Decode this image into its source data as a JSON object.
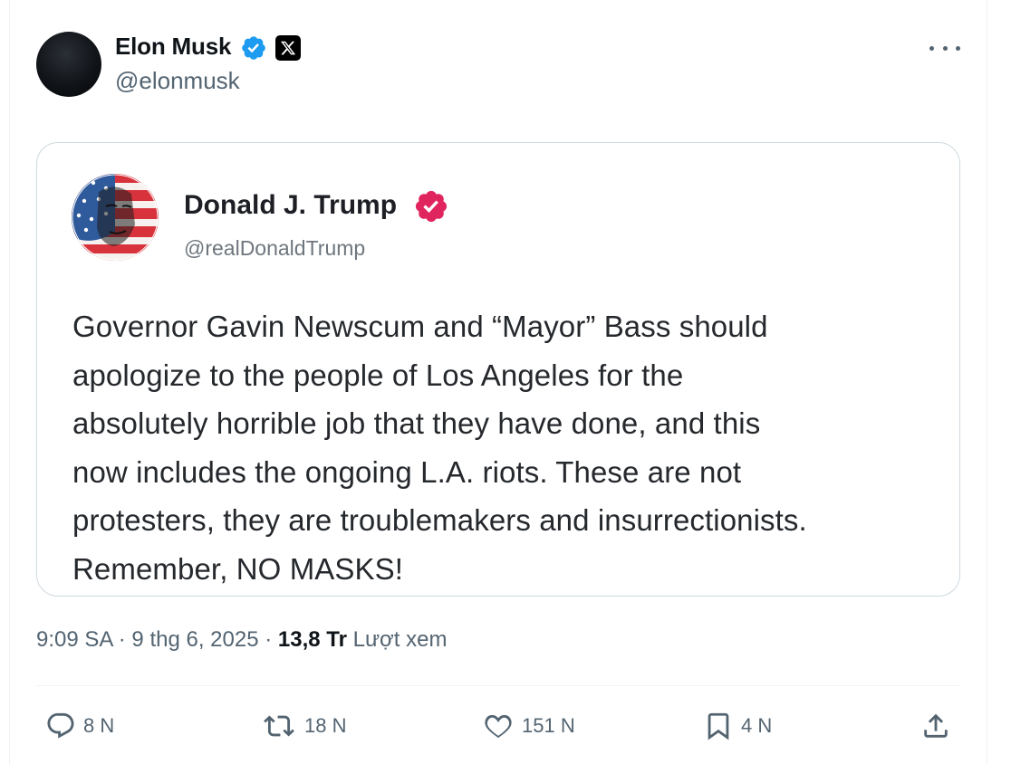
{
  "author": {
    "name": "Elon Musk",
    "handle": "@elonmusk",
    "verified_color": "#1d9bf0"
  },
  "quoted_post": {
    "name": "Donald J. Trump",
    "handle": "@realDonaldTrump",
    "verified_color": "#e0245e",
    "text": "Governor Gavin Newscum and “Mayor” Bass should\napologize to the people of Los Angeles for the\nabsolutely horrible job that they have done, and this\nnow includes the ongoing L.A. riots. These are not\nprotesters, they are troublemakers and insurrectionists.\nRemember, NO MASKS!"
  },
  "meta": {
    "time": "9:09 SA",
    "separator": "·",
    "date": "9 thg 6, 2025",
    "views_count": "13,8 Tr",
    "views_label": "Lượt xem"
  },
  "actions": {
    "replies": "8 N",
    "reposts": "18 N",
    "likes": "151 N",
    "bookmarks": "4 N"
  },
  "icons": {
    "verified": "verified-badge-icon",
    "x_logo": "x-logo-icon",
    "more": "more-icon",
    "reply": "reply-icon",
    "repost": "repost-icon",
    "like": "heart-icon",
    "bookmark": "bookmark-icon",
    "share": "share-icon"
  }
}
